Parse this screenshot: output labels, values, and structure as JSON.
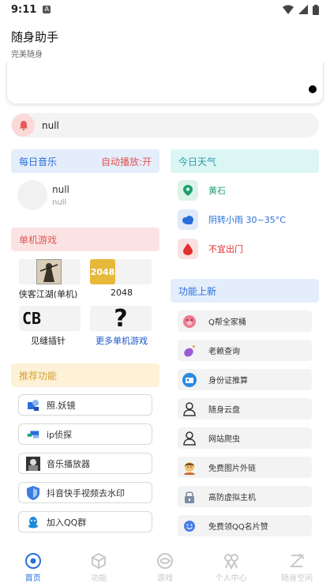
{
  "status_bar": {
    "time": "9:11"
  },
  "app": {
    "title": "随身助手",
    "subtitle": "完美随身"
  },
  "notice": {
    "text": "null"
  },
  "music": {
    "header": "每日音乐",
    "autoplay": "自动播放:开",
    "song": "null",
    "artist": "null"
  },
  "games": {
    "header": "单机游戏",
    "items": [
      {
        "label": "侠客江湖(单机)",
        "icon": "wuxia-game-icon"
      },
      {
        "label": "2048",
        "icon": "2048-game-icon",
        "badge": "2048"
      },
      {
        "label": "见缝插针",
        "icon": "cb-game-icon",
        "badge": "CB"
      },
      {
        "label": "更多单机游戏",
        "icon": "question-icon",
        "badge": "?"
      }
    ]
  },
  "recommended": {
    "header": "推荐功能",
    "items": [
      {
        "label": "照.妖镜",
        "icon": "mirror-icon"
      },
      {
        "label": "ip侦探",
        "icon": "ip-detective-icon"
      },
      {
        "label": "音乐播放器",
        "icon": "music-player-icon"
      },
      {
        "label": "抖音快手视频去水印",
        "icon": "shield-icon"
      },
      {
        "label": "加入QQ群",
        "icon": "qq-icon"
      }
    ]
  },
  "weather": {
    "header": "今日天气",
    "location": "黄石",
    "condition": "阴转小雨 30~35°C",
    "advice": "不宜出门",
    "colors": {
      "location": "#1aa06d",
      "condition": "#2a6edb",
      "advice": "#e03030"
    }
  },
  "new_features": {
    "header": "功能上新",
    "items": [
      {
        "label": "Q帮全家桶",
        "icon": "pig-icon"
      },
      {
        "label": "老赖查询",
        "icon": "eggplant-icon"
      },
      {
        "label": "身份证推算",
        "icon": "id-card-icon"
      },
      {
        "label": "随身云盘",
        "icon": "user-icon"
      },
      {
        "label": "网站爬虫",
        "icon": "user-icon"
      },
      {
        "label": "免费图片外链",
        "icon": "avatar-icon"
      },
      {
        "label": "高防虚拟主机",
        "icon": "lock-icon"
      },
      {
        "label": "免费领QQ名片赞",
        "icon": "smile-icon"
      }
    ]
  },
  "bottom_nav": {
    "items": [
      {
        "label": "首页",
        "icon": "home-icon",
        "active": true
      },
      {
        "label": "功能",
        "icon": "cube-icon",
        "active": false
      },
      {
        "label": "游戏",
        "icon": "game-icon",
        "active": false
      },
      {
        "label": "个人中心",
        "icon": "profile-icon",
        "active": false
      },
      {
        "label": "随身空间",
        "icon": "space-icon",
        "active": false
      }
    ]
  },
  "colors": {
    "accent": "#2a6edb"
  }
}
